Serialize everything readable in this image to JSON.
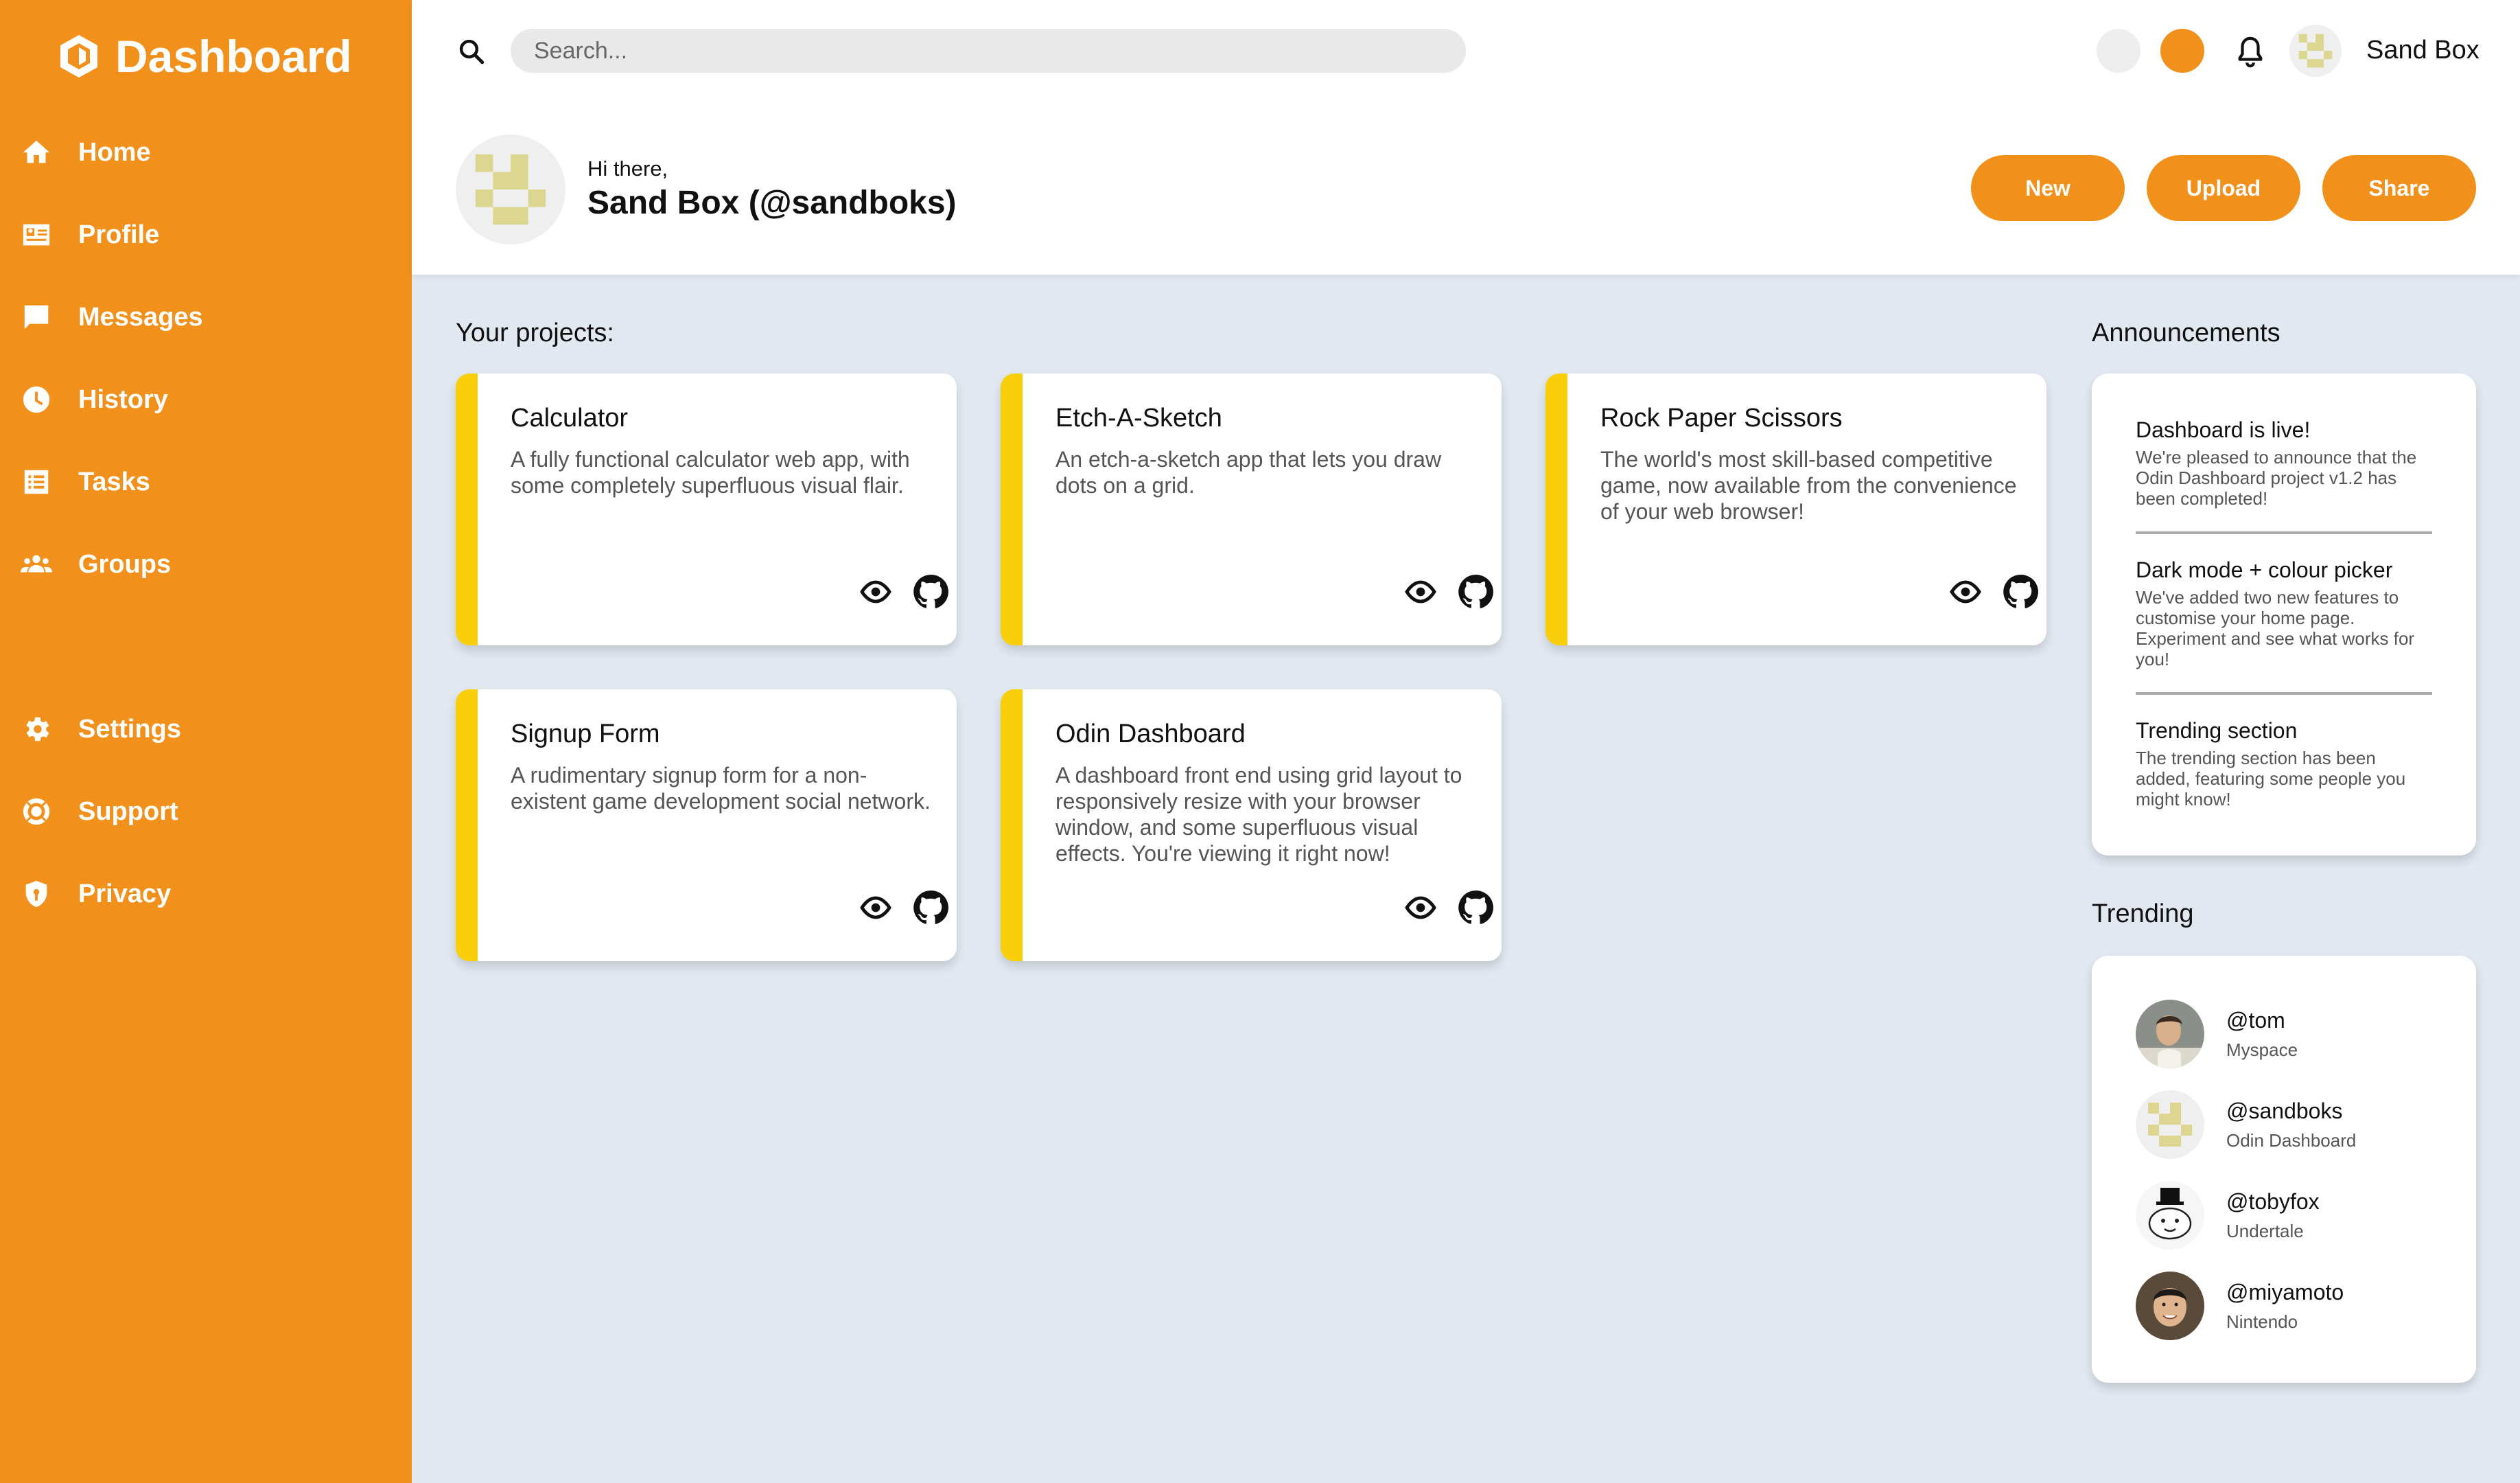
{
  "sidebar": {
    "brand": "Dashboard",
    "items": [
      {
        "label": "Home",
        "icon": "home-icon"
      },
      {
        "label": "Profile",
        "icon": "profile-card-icon"
      },
      {
        "label": "Messages",
        "icon": "message-icon"
      },
      {
        "label": "History",
        "icon": "clock-icon"
      },
      {
        "label": "Tasks",
        "icon": "list-icon"
      },
      {
        "label": "Groups",
        "icon": "groups-icon"
      },
      {
        "label": "Settings",
        "icon": "gear-icon"
      },
      {
        "label": "Support",
        "icon": "lifebuoy-icon"
      },
      {
        "label": "Privacy",
        "icon": "shield-icon"
      }
    ]
  },
  "header": {
    "search_placeholder": "Search...",
    "user_name": "Sand Box",
    "greeting": "Hi there,",
    "user_full": "Sand Box (@sandboks)",
    "buttons": {
      "new": "New",
      "upload": "Upload",
      "share": "Share"
    }
  },
  "projects": {
    "heading": "Your projects:",
    "items": [
      {
        "title": "Calculator",
        "desc": "A fully functional calculator web app, with some completely superfluous visual flair."
      },
      {
        "title": "Etch-A-Sketch",
        "desc": "An etch-a-sketch app that lets you draw dots on a grid."
      },
      {
        "title": "Rock Paper Scissors",
        "desc": "The world's most skill-based competitive game, now available from the convenience of your web browser!"
      },
      {
        "title": "Signup Form",
        "desc": "A rudimentary signup form for a non-existent game development social network."
      },
      {
        "title": "Odin Dashboard",
        "desc": "A dashboard front end using grid layout to responsively resize with your browser window, and some superfluous visual effects. You're viewing it right now!"
      }
    ]
  },
  "announcements": {
    "heading": "Announcements",
    "items": [
      {
        "title": "Dashboard is live!",
        "body": "We're pleased to announce that the Odin Dashboard project v1.2 has been completed!"
      },
      {
        "title": "Dark mode + colour picker",
        "body": "We've added two new features to customise your home page. Experiment and see what works for you!"
      },
      {
        "title": "Trending section",
        "body": "The trending section has been added, featuring some people you might know!"
      }
    ]
  },
  "trending": {
    "heading": "Trending",
    "items": [
      {
        "handle": "@tom",
        "sub": "Myspace"
      },
      {
        "handle": "@sandboks",
        "sub": "Odin Dashboard"
      },
      {
        "handle": "@tobyfox",
        "sub": "Undertale"
      },
      {
        "handle": "@miyamoto",
        "sub": "Nintendo"
      }
    ]
  },
  "colors": {
    "accent": "#f2901c",
    "card_stripe": "#f8cf0a",
    "background": "#e2e8f0"
  }
}
